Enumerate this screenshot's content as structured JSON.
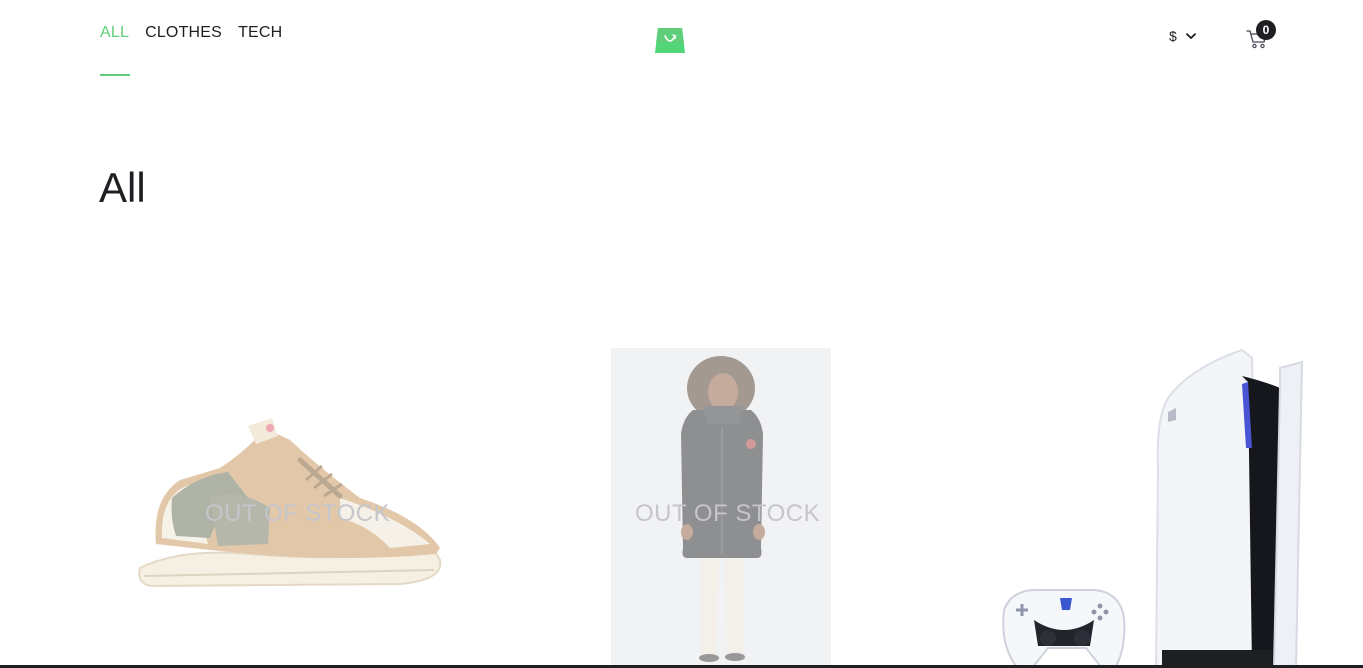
{
  "header": {
    "nav": [
      "ALL",
      "CLOTHES",
      "TECH"
    ],
    "active_nav": "ALL",
    "currency_symbol": "$",
    "cart_count": "0"
  },
  "main": {
    "category_title": "All",
    "products": [
      {
        "image_icon": "sneaker-image",
        "out_of_stock_label": "OUT OF STOCK",
        "in_stock": false
      },
      {
        "image_icon": "jacket-model-image",
        "out_of_stock_label": "OUT OF STOCK",
        "in_stock": false
      },
      {
        "image_icon": "console-image",
        "in_stock": true
      }
    ]
  },
  "colors": {
    "accent": "#5ece7b",
    "text": "#1d1f22",
    "out_of_stock_text": "#8d8f9a"
  }
}
